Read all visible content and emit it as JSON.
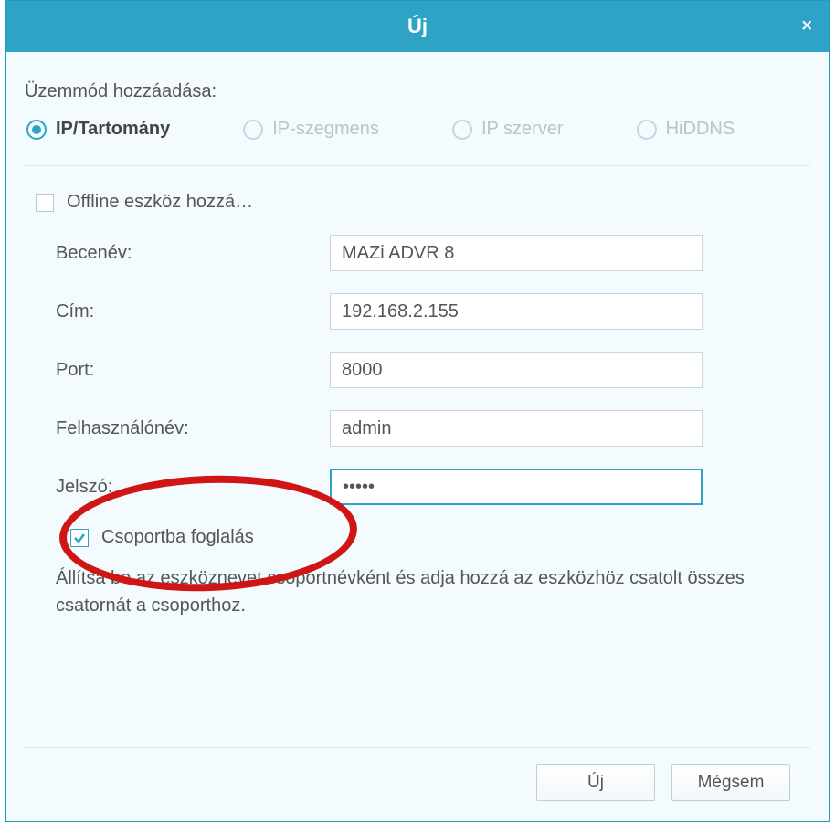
{
  "title": "Új",
  "mode_label": "Üzemmód hozzáadása:",
  "radios": {
    "ip_domain": "IP/Tartomány",
    "ip_segment": "IP-szegmens",
    "ip_server": "IP szerver",
    "hiddns": "HiDDNS"
  },
  "offline_label": "Offline eszköz hozzá…",
  "fields": {
    "nickname_label": "Becenév:",
    "nickname_value": "MAZi ADVR 8",
    "address_label": "Cím:",
    "address_value": "192.168.2.155",
    "port_label": "Port:",
    "port_value": "8000",
    "username_label": "Felhasználónév:",
    "username_value": "admin",
    "password_label": "Jelszó:",
    "password_value": "•••••"
  },
  "group_label": "Csoportba foglalás",
  "description": "Állítsa be az eszköznevet csoportnévként és adja hozzá az eszközhöz csatolt összes csatornát a csoporthoz.",
  "buttons": {
    "new": "Új",
    "cancel": "Mégsem"
  }
}
